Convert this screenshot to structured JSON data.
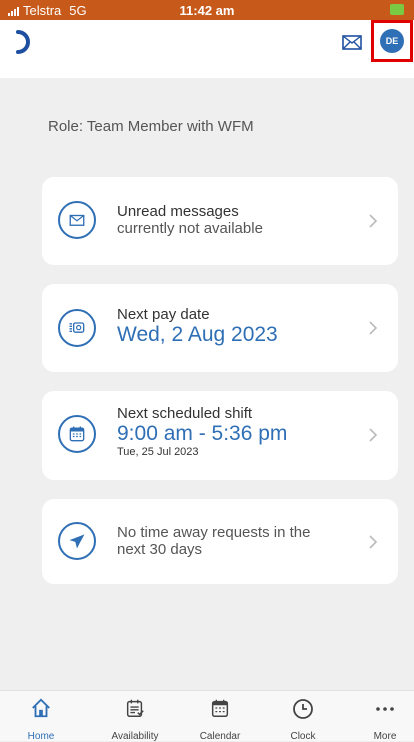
{
  "status_bar": {
    "carrier": "Telstra",
    "network": "5G",
    "time": "11:42 am"
  },
  "header": {
    "logo_icon": "crescent-logo-icon",
    "mail_icon": "envelope-icon",
    "avatar_initials": "DE"
  },
  "role_text": "Role: Team Member with WFM",
  "cards": [
    {
      "icon": "envelope-icon",
      "title": "Unread messages",
      "subtitle": "currently not available"
    },
    {
      "icon": "money-icon",
      "title": "Next pay date",
      "value": "Wed, 2 Aug 2023"
    },
    {
      "icon": "calendar-icon",
      "title": "Next scheduled shift",
      "value": "9:00 am - 5:36 pm",
      "date": "Tue, 25 Jul 2023"
    },
    {
      "icon": "airplane-icon",
      "title": "No time away requests in the",
      "subtitle": "next 30 days"
    }
  ],
  "tabs": [
    {
      "label": "Home",
      "icon": "home-icon",
      "active": true
    },
    {
      "label": "Availability",
      "icon": "availability-icon"
    },
    {
      "label": "Calendar",
      "icon": "calendar-icon"
    },
    {
      "label": "Clock",
      "icon": "clock-icon"
    },
    {
      "label": "More",
      "icon": "more-icon"
    }
  ],
  "colors": {
    "accent": "#2f6fb5",
    "status_bar": "#c75a1a",
    "highlight": "#e00000"
  }
}
